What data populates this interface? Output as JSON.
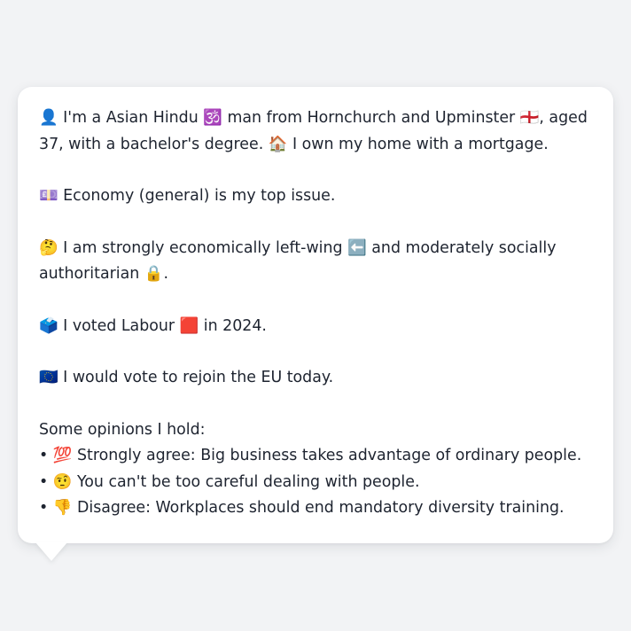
{
  "message": {
    "intro": "👤 I'm a Asian Hindu 🕉️ man from Hornchurch and Upminster 🏴󠁧󠁢󠁥󠁮󠁧󠁿, aged 37, with a bachelor's degree. 🏠 I own my home with a mortgage.",
    "top_issue": "💷 Economy (general) is my top issue.",
    "ideology": "🤔 I am strongly economically left-wing ⬅️ and moderately socially authoritarian 🔒.",
    "vote": "🗳️ I voted Labour 🟥 in 2024.",
    "eu": "🇪🇺 I would vote to rejoin the EU today.",
    "opinions_title": "Some opinions I hold:",
    "opinions": [
      "• 💯 Strongly agree: Big business takes advantage of ordinary people.",
      "• 🤨 You can't be too careful dealing with people.",
      "• 👎 Disagree: Workplaces should end mandatory diversity training."
    ]
  }
}
